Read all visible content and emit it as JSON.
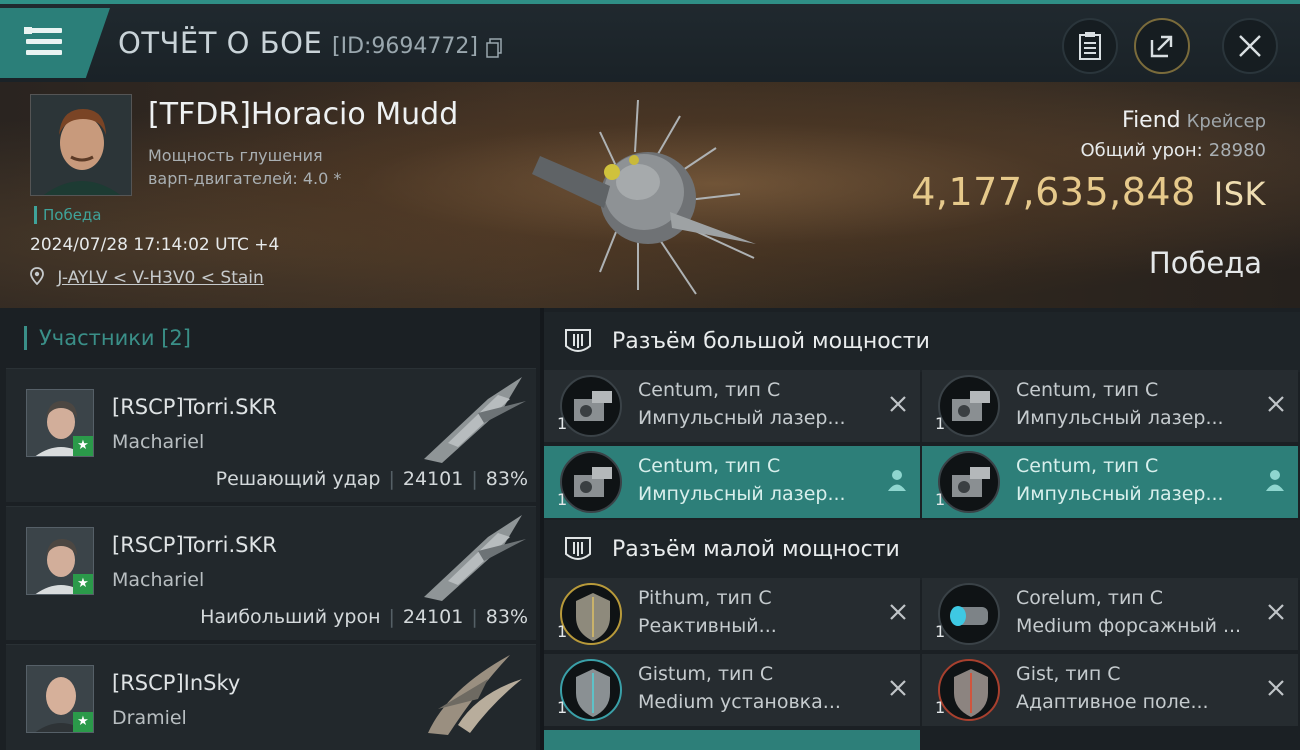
{
  "header": {
    "title": "ОТЧЁТ О БОЕ",
    "id_text": "[ID:9694772]",
    "icons": [
      "menu-icon",
      "clipboard-icon",
      "share-icon",
      "close-icon"
    ]
  },
  "hero": {
    "pilot_name": "[TFDR]Horacio Mudd",
    "pilot_stat_line1": "Мощность глушения",
    "pilot_stat_line2": "варп-двигателей: 4.0 *",
    "victory_tag": "Победа",
    "datetime": "2024/07/28 17:14:02 UTC +4",
    "location": "J-AYLV < V-H3V0 < Stain",
    "ship_name": "Fiend",
    "ship_class": "Крейсер",
    "damage_label": "Общий урон:",
    "damage_value": "28980",
    "isk_value": "4,177,635,848",
    "isk_currency": "ISK",
    "result": "Победа"
  },
  "participants": {
    "title": "Участники [2]",
    "items": [
      {
        "name": "[RSCP]Torri.SKR",
        "ship": "Machariel",
        "role": "Решающий удар",
        "damage": "24101",
        "percent": "83%"
      },
      {
        "name": "[RSCP]Torri.SKR",
        "ship": "Machariel",
        "role": "Наибольший урон",
        "damage": "24101",
        "percent": "83%"
      },
      {
        "name": "[RSCP]InSky",
        "ship": "Dramiel",
        "role": "",
        "damage": "",
        "percent": ""
      }
    ]
  },
  "slots": {
    "high_title": "Разъём большой мощности",
    "low_title": "Разъём малой мощности",
    "high": [
      {
        "name": "Centum, тип C",
        "desc": "Импульсный лазер...",
        "qty": "1",
        "active": false
      },
      {
        "name": "Centum, тип C",
        "desc": "Импульсный лазер...",
        "qty": "1",
        "active": false
      },
      {
        "name": "Centum, тип C",
        "desc": "Импульсный лазер...",
        "qty": "1",
        "active": true
      },
      {
        "name": "Centum, тип C",
        "desc": "Импульсный лазер...",
        "qty": "1",
        "active": true
      }
    ],
    "low": [
      {
        "name": "Pithum, тип C",
        "desc": "Реактивный...",
        "qty": "1",
        "active": false
      },
      {
        "name": "Corelum, тип C",
        "desc": "Medium форсажный ...",
        "qty": "1",
        "active": false
      },
      {
        "name": "Gistum, тип C",
        "desc": "Medium установка...",
        "qty": "1",
        "active": false
      },
      {
        "name": "Gist, тип C",
        "desc": "Адаптивное поле...",
        "qty": "1",
        "active": false
      }
    ]
  },
  "colors": {
    "accent": "#2d7f79",
    "isk": "#e6c98b",
    "victory": "#3fa39a"
  }
}
